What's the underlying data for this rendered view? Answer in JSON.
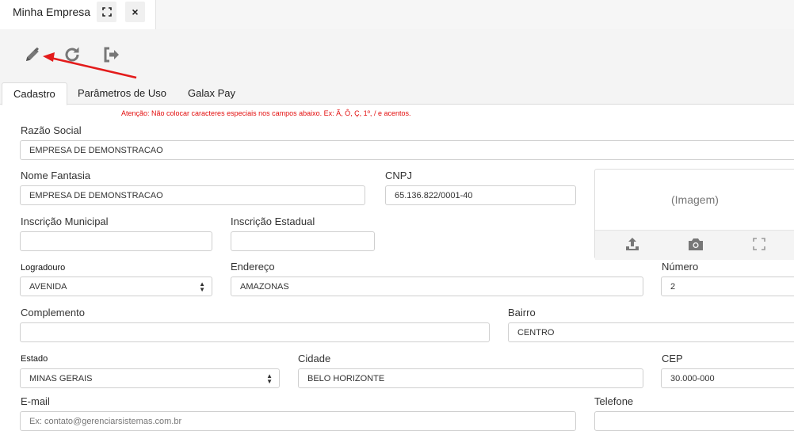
{
  "window": {
    "tab_title": "Minha Empresa",
    "expand_icon": "expand-icon",
    "close_label": "×"
  },
  "toolbar": {
    "icons": [
      "pencil-icon",
      "refresh-icon",
      "sign-out-icon"
    ],
    "annotation_arrow_color": "#e31b1b"
  },
  "tabs": [
    {
      "label": "Cadastro",
      "active": true
    },
    {
      "label": "Parâmetros de Uso",
      "active": false
    },
    {
      "label": "Galax Pay",
      "active": false
    }
  ],
  "warning": "Atenção: Não colocar caracteres especiais nos campos abaixo. Ex: Ã, Ô, Ç, 1º, / e acentos.",
  "form": {
    "razao_social": {
      "label": "Razão Social",
      "value": "EMPRESA DE DEMONSTRACAO"
    },
    "nome_fantasia": {
      "label": "Nome Fantasia",
      "value": "EMPRESA DE DEMONSTRACAO"
    },
    "cnpj": {
      "label": "CNPJ",
      "value": "65.136.822/0001-40"
    },
    "inscricao_municipal": {
      "label": "Inscrição Municipal",
      "value": ""
    },
    "inscricao_estadual": {
      "label": "Inscrição Estadual",
      "value": ""
    },
    "logradouro": {
      "label": "Logradouro",
      "value": "AVENIDA"
    },
    "endereco": {
      "label": "Endereço",
      "value": "AMAZONAS"
    },
    "numero": {
      "label": "Número",
      "value": "2"
    },
    "complemento": {
      "label": "Complemento",
      "value": ""
    },
    "bairro": {
      "label": "Bairro",
      "value": "CENTRO"
    },
    "estado": {
      "label": "Estado",
      "value": "MINAS GERAIS"
    },
    "cidade": {
      "label": "Cidade",
      "value": "BELO HORIZONTE"
    },
    "cep": {
      "label": "CEP",
      "value": "30.000-000"
    },
    "email": {
      "label": "E-mail",
      "placeholder": "Ex: contato@gerenciarsistemas.com.br"
    },
    "telefone": {
      "label": "Telefone",
      "value": ""
    }
  },
  "image_panel": {
    "placeholder": "(Imagem)",
    "icons": [
      "upload-icon",
      "camera-icon",
      "fullscreen-icon"
    ]
  },
  "colors": {
    "warning": "#e30d0d",
    "icon_gray": "#777777"
  }
}
